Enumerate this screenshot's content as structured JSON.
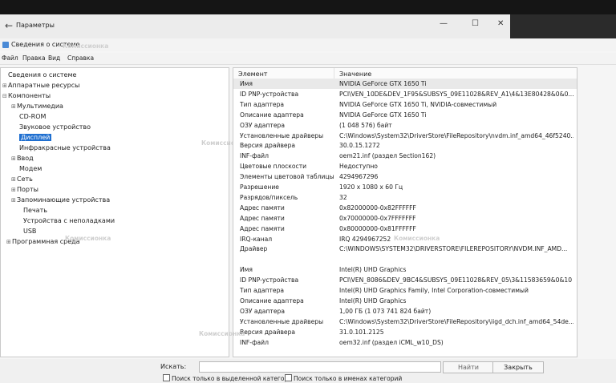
{
  "settings_window": {
    "back_glyph": "←",
    "title": "Параметры",
    "controls": [
      "—",
      "☐",
      "✕"
    ]
  },
  "window": {
    "title": "Сведения о системе",
    "menu": [
      "Файл",
      "Правка",
      "Вид",
      "Справка"
    ]
  },
  "tree": [
    {
      "label": "Сведения о системе",
      "pm": ""
    },
    {
      "label": "Аппаратные ресурсы",
      "pm": "⊞"
    },
    {
      "label": "Компоненты",
      "pm": "⊟"
    },
    {
      "label": "Мультимедиа",
      "pm": "⊞"
    },
    {
      "label": "CD-ROM",
      "pm": ""
    },
    {
      "label": "Звуковое устройство",
      "pm": ""
    },
    {
      "label": "Дисплей",
      "pm": "",
      "selected": true
    },
    {
      "label": "Инфракрасные устройства",
      "pm": ""
    },
    {
      "label": "Ввод",
      "pm": "⊞"
    },
    {
      "label": "Модем",
      "pm": ""
    },
    {
      "label": "Сеть",
      "pm": "⊞"
    },
    {
      "label": "Порты",
      "pm": "⊞"
    },
    {
      "label": "Запоминающие устройства",
      "pm": "⊞"
    },
    {
      "label": "Печать",
      "pm": ""
    },
    {
      "label": "Устройства с неполадками",
      "pm": ""
    },
    {
      "label": "USB",
      "pm": ""
    },
    {
      "label": "Программная среда",
      "pm": "⊞"
    }
  ],
  "table": {
    "col_element": "Элемент",
    "col_value": "Значение",
    "rows": [
      {
        "k": "Имя",
        "v": "NVIDIA GeForce GTX 1650 Ti"
      },
      {
        "k": "ID PNP-устройства",
        "v": "PCI\\VEN_10DE&DEV_1F95&SUBSYS_09E11028&REV_A1\\4&13E80428&0&0..."
      },
      {
        "k": "Тип адаптера",
        "v": "NVIDIA GeForce GTX 1650 Ti, NVIDIA-совместимый"
      },
      {
        "k": "Описание адаптера",
        "v": "NVIDIA GeForce GTX 1650 Ti"
      },
      {
        "k": "ОЗУ адаптера",
        "v": "(1 048 576) байт"
      },
      {
        "k": "Установленные драйверы",
        "v": "C:\\Windows\\System32\\DriverStore\\FileRepository\\nvdm.inf_amd64_46f5240..."
      },
      {
        "k": "Версия драйвера",
        "v": "30.0.15.1272"
      },
      {
        "k": "INF-файл",
        "v": "oem21.inf (раздел Section162)"
      },
      {
        "k": "Цветовые плоскости",
        "v": "Недоступно"
      },
      {
        "k": "Элементы цветовой таблицы",
        "v": "4294967296"
      },
      {
        "k": "Разрешение",
        "v": "1920 x 1080 x 60 Гц"
      },
      {
        "k": "Разрядов/пиксель",
        "v": "32"
      },
      {
        "k": "Адрес памяти",
        "v": "0x82000000-0x82FFFFFF"
      },
      {
        "k": "Адрес памяти",
        "v": "0x70000000-0x7FFFFFFF"
      },
      {
        "k": "Адрес памяти",
        "v": "0x80000000-0x81FFFFFF"
      },
      {
        "k": "IRQ-канал",
        "v": "IRQ 4294967252"
      },
      {
        "k": "Драйвер",
        "v": "C:\\WINDOWS\\SYSTEM32\\DRIVERSTORE\\FILEREPOSITORY\\NVDM.INF_AMD..."
      },
      {
        "k": "",
        "v": ""
      },
      {
        "k": "Имя",
        "v": "Intel(R) UHD Graphics"
      },
      {
        "k": "ID PNP-устройства",
        "v": "PCI\\VEN_8086&DEV_9BC4&SUBSYS_09E11028&REV_05\\3&11583659&0&10"
      },
      {
        "k": "Тип адаптера",
        "v": "Intel(R) UHD Graphics Family, Intel Corporation-совместимый"
      },
      {
        "k": "Описание адаптера",
        "v": "Intel(R) UHD Graphics"
      },
      {
        "k": "ОЗУ адаптера",
        "v": "1,00 ГБ (1 073 741 824 байт)"
      },
      {
        "k": "Установленные драйверы",
        "v": "C:\\Windows\\System32\\DriverStore\\FileRepository\\iigd_dch.inf_amd64_54de..."
      },
      {
        "k": "Версия драйвера",
        "v": "31.0.101.2125"
      },
      {
        "k": "INF-файл",
        "v": "oem32.inf (раздел iCML_w10_DS)"
      }
    ]
  },
  "search": {
    "label": "Искать:",
    "value": "",
    "find_button": "Найти",
    "close_button": "Закрыть",
    "check_selected": "Поиск только в выделенной категор",
    "check_names": "Поиск только в именах категорий"
  },
  "watermark": "Комиссионка"
}
